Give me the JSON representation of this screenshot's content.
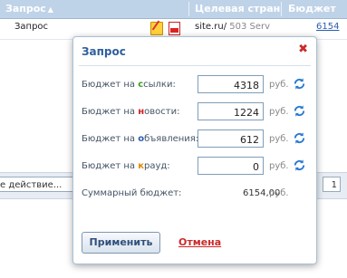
{
  "table": {
    "col_request": "Запрос",
    "col_target_page": "Целевая стран",
    "col_budget": "Бюджет",
    "row": {
      "request": "Запрос",
      "site": "site.ru/",
      "status": "503 Serv",
      "budget": "6154"
    }
  },
  "bulk": {
    "action_placeholder": "е действие...",
    "page_value": "1"
  },
  "modal": {
    "title": "Запрос",
    "fields": [
      {
        "label_pre": "Бюджет на ",
        "label_hl": "с",
        "label_post": "сылки:",
        "value": "4318",
        "unit": "руб."
      },
      {
        "label_pre": "Бюджет на ",
        "label_hl": "н",
        "label_post": "овости:",
        "value": "1224",
        "unit": "руб."
      },
      {
        "label_pre": "Бюджет на ",
        "label_hl": "о",
        "label_post": "бъявления:",
        "value": "612",
        "unit": "руб."
      },
      {
        "label_pre": "Бюджет на ",
        "label_hl": "к",
        "label_post": "рауд:",
        "value": "0",
        "unit": "руб."
      }
    ],
    "total_label": "Суммарный бюджет:",
    "total_value": "6154,00",
    "total_unit": "руб.",
    "apply_label": "Применить",
    "cancel_label": "Отмена"
  }
}
